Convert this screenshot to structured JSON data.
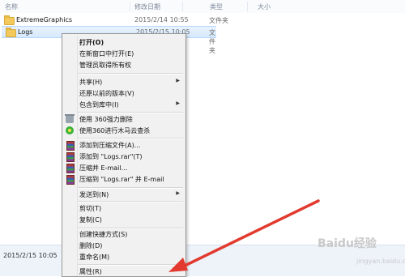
{
  "header": {
    "name": "名称",
    "date": "修改日期",
    "type": "类型",
    "size": "大小"
  },
  "files": [
    {
      "name": "ExtremeGraphics",
      "date": "2015/2/14 10:55",
      "type": "文件夹"
    },
    {
      "name": "Logs",
      "date": "2015/2/15 10:05",
      "type": "文件夹"
    }
  ],
  "status": {
    "date": "2015/2/15 10:05"
  },
  "menu": {
    "open": "打开(O)",
    "open_new_window": "在新窗口中打开(E)",
    "take_ownership": "管理员取得所有权",
    "share": "共享(H)",
    "restore_versions": "还原以前的版本(V)",
    "include_library": "包含到库中(I)",
    "force_delete_360": "使用 360强力删除",
    "trojan_scan_360": "使用360进行木马云查杀",
    "add_to_archive": "添加到压缩文件(A)...",
    "add_to_logs_rar": "添加到 \"Logs.rar\"(T)",
    "compress_email": "压缩并 E-mail...",
    "compress_logs_email": "压缩到 \"Logs.rar\" 并 E-mail",
    "send_to": "发送到(N)",
    "cut": "剪切(T)",
    "copy": "复制(C)",
    "create_shortcut": "创建快捷方式(S)",
    "delete": "删除(D)",
    "rename": "重命名(M)",
    "properties": "属性(R)"
  },
  "watermark": {
    "brand": "Baidu经验",
    "url": "jingyan.baidu.com"
  }
}
